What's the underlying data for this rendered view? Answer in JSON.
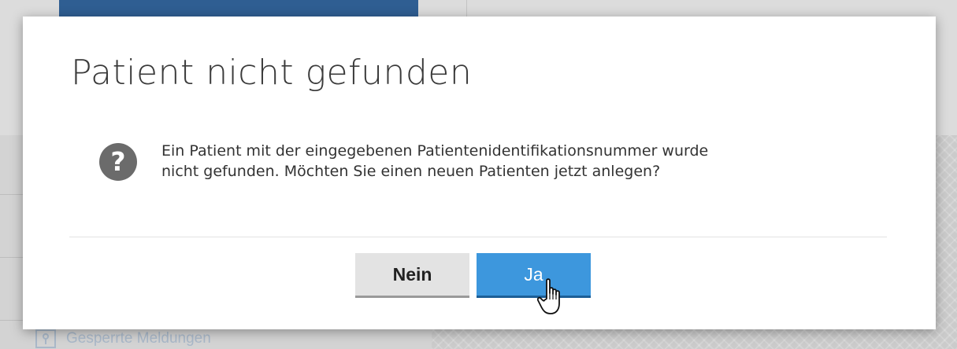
{
  "dialog": {
    "title": "Patient nicht gefunden",
    "message_line1": "Ein Patient mit der eingegebenen Patientenidentifikationsnummer wurde",
    "message_line2": "nicht gefunden. Möchten Sie einen neuen Patienten jetzt anlegen?",
    "icon": "question-icon",
    "icon_glyph": "?",
    "buttons": {
      "no_label": "Nein",
      "yes_label": "Ja"
    }
  },
  "background": {
    "sidebar_item_label": "Gesperrte Meldungen",
    "sidebar_item_icon": "lock-icon"
  },
  "colors": {
    "primary_button": "#3d97dd",
    "secondary_button": "#e3e3e3",
    "header_tab": "#2f5e92",
    "icon_gray": "#6b6b6b"
  }
}
